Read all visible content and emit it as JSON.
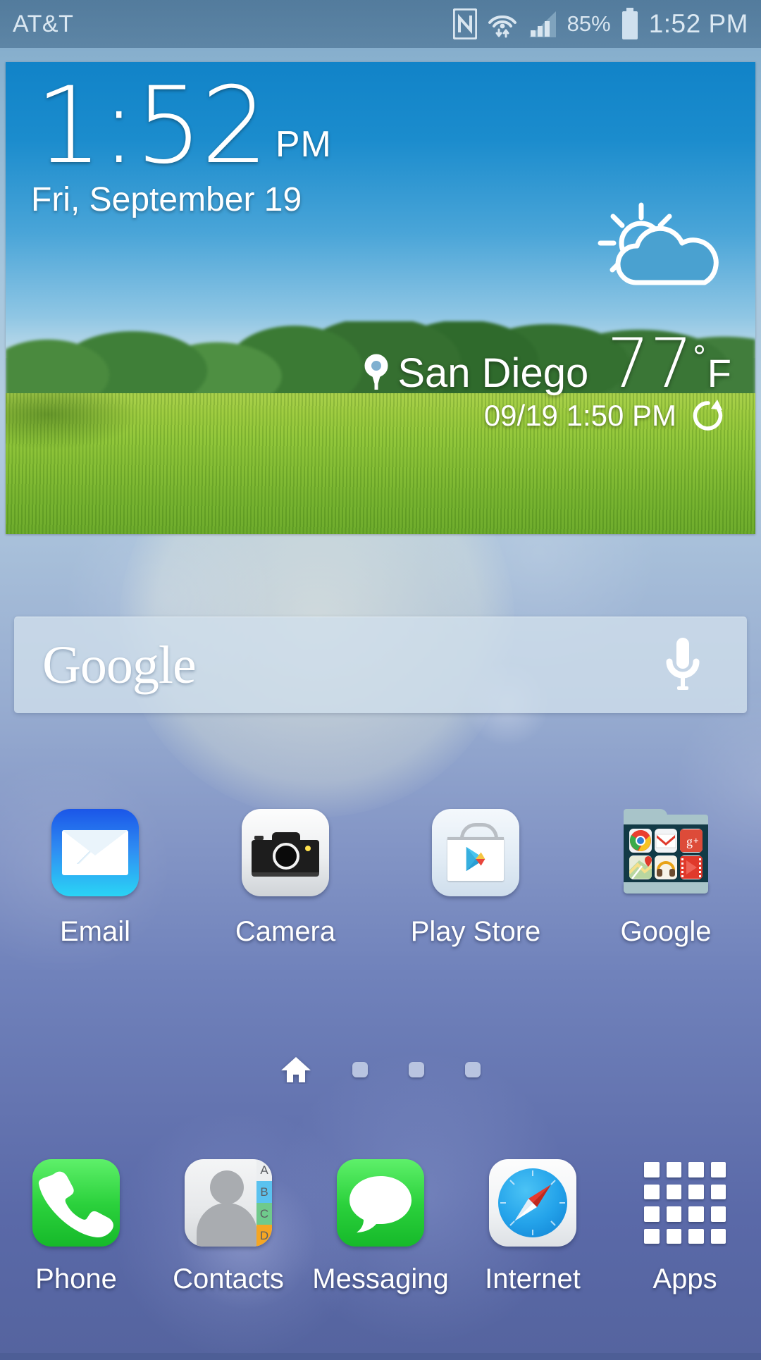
{
  "statusbar": {
    "carrier": "AT&T",
    "battery_percent": "85%",
    "clock": "1:52 PM",
    "icons": [
      "nfc-icon",
      "wifi-icon",
      "signal-icon",
      "battery-icon"
    ]
  },
  "weather_widget": {
    "time": "1:52",
    "ampm": "PM",
    "date": "Fri, September 19",
    "city": "San Diego",
    "temperature": "77",
    "degree_symbol": "°",
    "unit": "F",
    "updated": "09/19 1:50 PM",
    "condition_icon": "partly-cloudy-icon",
    "refresh_icon": "refresh-icon",
    "location_icon": "location-pin-icon"
  },
  "search": {
    "logo": "Google",
    "mic_icon": "microphone-icon"
  },
  "apps": [
    {
      "label": "Email",
      "icon": "email-icon"
    },
    {
      "label": "Camera",
      "icon": "camera-icon"
    },
    {
      "label": "Play Store",
      "icon": "play-store-icon"
    },
    {
      "label": "Google",
      "icon": "google-folder-icon"
    }
  ],
  "folder": {
    "name": "Google",
    "items": [
      "Chrome",
      "Gmail",
      "Google+",
      "Maps",
      "Play Music",
      "Play Movies"
    ]
  },
  "page_indicator": {
    "total_pages": 4,
    "current_page": 1,
    "home_icon": "home-icon"
  },
  "dock": [
    {
      "label": "Phone",
      "icon": "phone-icon"
    },
    {
      "label": "Contacts",
      "icon": "contacts-icon"
    },
    {
      "label": "Messaging",
      "icon": "message-bubble-icon"
    },
    {
      "label": "Internet",
      "icon": "compass-icon"
    },
    {
      "label": "Apps",
      "icon": "apps-grid-icon"
    }
  ],
  "contacts_tabs": [
    "A",
    "B",
    "C",
    "D"
  ],
  "colors": {
    "status_bar": "#3f6a8a",
    "widget_sky": "#1183c8",
    "grass": "#8dc437",
    "search_bar": "#cfdeeb",
    "phone_green": "#2bd13c",
    "folder_body": "#123a46",
    "folder_tab": "#a8c4c9"
  }
}
